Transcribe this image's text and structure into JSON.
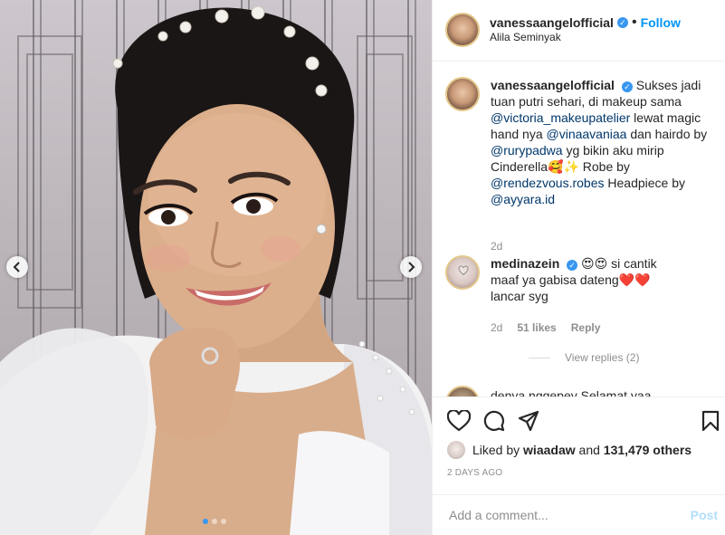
{
  "header": {
    "username": "vanessaangelofficial",
    "separator": "•",
    "follow_label": "Follow",
    "location": "Alila Seminyak"
  },
  "caption": {
    "username": "vanessaangelofficial",
    "parts": {
      "p1": "Sukses jadi tuan putri sehari, di makeup sama ",
      "m1": "@victoria_makeupatelier",
      "p2": " lewat magic hand nya ",
      "m2": "@vinaavaniaa",
      "p3": " dan hairdo by ",
      "m3": "@rurypadwa",
      "p4": " yg bikin aku mirip Cinderella🥰✨ Robe by ",
      "m4": "@rendezvous.robes",
      "p5": " Headpiece by ",
      "m5": "@ayyara.id"
    },
    "time": "2d"
  },
  "comments": [
    {
      "username": "medinazein",
      "text": "😍😍 si cantik maaf ya gabisa dateng❤️❤️ lancar syg",
      "time": "2d",
      "likes": "51 likes",
      "reply_label": "Reply"
    }
  ],
  "view_replies": "View replies (2)",
  "partial_comment": "denya.nggepey Selamat yaa",
  "likes": {
    "prefix": "Liked by",
    "user": "wiaadaw",
    "and": "and",
    "count": "131,479 others"
  },
  "posted_ago": "2 DAYS AGO",
  "add_comment": {
    "placeholder": "Add a comment...",
    "post_label": "Post"
  },
  "carousel": {
    "slide_count": 3,
    "active_index": 0
  },
  "icons": {
    "prev": "chevron-left-icon",
    "next": "chevron-right-icon",
    "like": "heart-icon",
    "comment": "comment-icon",
    "share": "share-icon",
    "save": "bookmark-icon",
    "verified": "verified-badge-icon"
  },
  "colors": {
    "accent": "#0095f6",
    "verified": "#3897f0",
    "mention": "#00376b",
    "muted": "#8e8e8e",
    "post_disabled": "#b2dffc"
  }
}
